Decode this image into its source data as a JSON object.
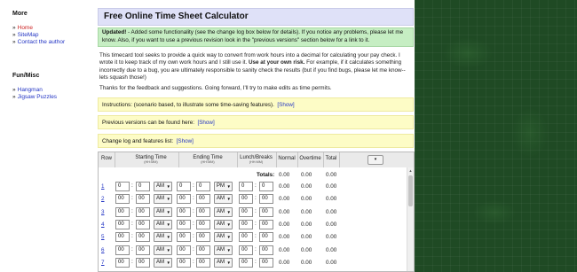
{
  "sidebar": {
    "more_title": "More",
    "more_links": [
      "Home",
      "SiteMap",
      "Contact the author"
    ],
    "funmisc_title": "Fun/Misc",
    "fun_links": [
      "Hangman",
      "Jigsaw Puzzles"
    ]
  },
  "page_title": "Free Online Time Sheet Calculator",
  "notice": {
    "bold": "Updated!",
    "text": " - Added some functionality (see the change log box below for details). If you notice any problems, please let me know. Also, if you want to use a previous revision look in the \"previous versions\" section below for a link to it."
  },
  "intro": {
    "text1": "This timecard tool seeks to provide a quick way to convert from work hours into a decimal for calculating your pay check. I wrote it to keep track of my own work hours and I still use it. ",
    "bold": "Use at your own risk.",
    "text2": " For example, if it calculates something incorrectly due to a bug, you are ultimately responsible to sanity check the results (but if you find bugs, please let me know--lets squash those!)"
  },
  "thanks": "Thanks for the feedback and suggestions. Going forward, I'll try to make edits as time permits.",
  "boxes": {
    "instructions": "Instructions: (scenario based, to illustrate some time-saving features).",
    "previous": "Previous versions can be found here:",
    "changelog": "Change log and features list:",
    "show": "[Show]"
  },
  "table": {
    "headers": {
      "row": "Row",
      "starting": "Starting Time",
      "ending": "Ending Time",
      "hhmm": "(HH:MM)",
      "lunch": "Lunch/Breaks",
      "normal": "Normal",
      "overtime": "Overtime",
      "total": "Total"
    },
    "expand_symbol": "▾",
    "totals_label": "Totals:",
    "totals": [
      "0.00",
      "0.00",
      "0.00"
    ],
    "rows": [
      {
        "num": "1",
        "sh": "0",
        "sm": "0",
        "sampm": "AM",
        "eh": "0",
        "em": "0",
        "eampm": "PM",
        "lh": "0",
        "lm": "0",
        "normal": "0.00",
        "overtime": "0.00",
        "total": "0.00"
      },
      {
        "num": "2",
        "sh": "00",
        "sm": "00",
        "sampm": "AM",
        "eh": "00",
        "em": "00",
        "eampm": "AM",
        "lh": "00",
        "lm": "00",
        "normal": "0.00",
        "overtime": "0.00",
        "total": "0.00"
      },
      {
        "num": "3",
        "sh": "00",
        "sm": "00",
        "sampm": "AM",
        "eh": "00",
        "em": "00",
        "eampm": "AM",
        "lh": "00",
        "lm": "00",
        "normal": "0.00",
        "overtime": "0.00",
        "total": "0.00"
      },
      {
        "num": "4",
        "sh": "00",
        "sm": "00",
        "sampm": "AM",
        "eh": "00",
        "em": "00",
        "eampm": "AM",
        "lh": "00",
        "lm": "00",
        "normal": "0.00",
        "overtime": "0.00",
        "total": "0.00"
      },
      {
        "num": "5",
        "sh": "00",
        "sm": "00",
        "sampm": "AM",
        "eh": "00",
        "em": "00",
        "eampm": "AM",
        "lh": "00",
        "lm": "00",
        "normal": "0.00",
        "overtime": "0.00",
        "total": "0.00"
      },
      {
        "num": "6",
        "sh": "00",
        "sm": "00",
        "sampm": "AM",
        "eh": "00",
        "em": "00",
        "eampm": "AM",
        "lh": "00",
        "lm": "00",
        "normal": "0.00",
        "overtime": "0.00",
        "total": "0.00"
      },
      {
        "num": "7",
        "sh": "00",
        "sm": "00",
        "sampm": "AM",
        "eh": "00",
        "em": "00",
        "eampm": "AM",
        "lh": "00",
        "lm": "00",
        "normal": "0.00",
        "overtime": "0.00",
        "total": "0.00"
      }
    ]
  },
  "colors": {
    "link": "#2234c4",
    "title_bg": "#dfe1f8",
    "notice_bg": "#c6eec3",
    "yellow_bg": "#fdfcc6",
    "side_bg": "#1f4a24"
  }
}
